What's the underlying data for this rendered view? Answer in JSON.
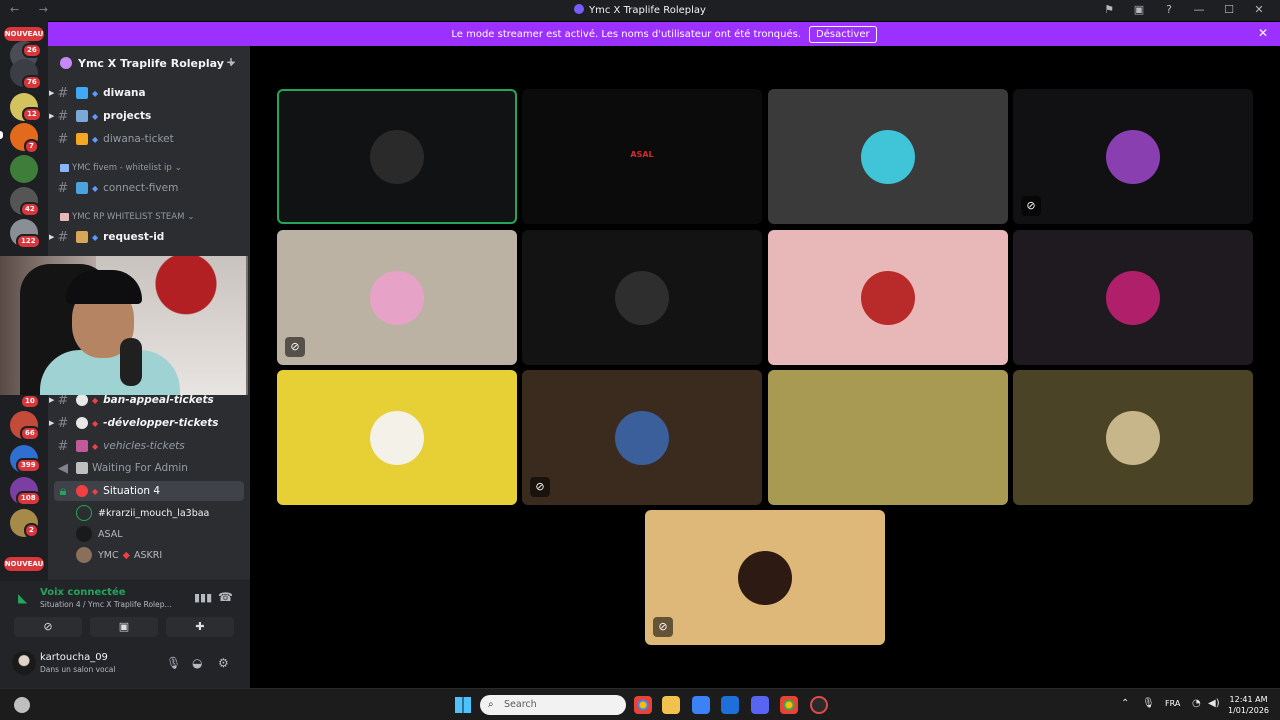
{
  "window": {
    "title": "Ymc X Traplife Roleplay",
    "nav_icons": "← →",
    "controls": [
      "⚑",
      "▣",
      "?",
      "—",
      "☐",
      "✕"
    ]
  },
  "banner": {
    "text": "Le mode streamer est activé. Les noms d'utilisateur ont été tronqués.",
    "button": "Désactiver",
    "close": "✕",
    "color": "#9b30ff"
  },
  "rail": {
    "new_label": "NOUVEAU",
    "badges": [
      "26",
      "76",
      "12",
      "7",
      "42",
      "122",
      "10",
      "66",
      "399",
      "108",
      "2"
    ]
  },
  "server": {
    "name": "Ymc X Traplife Roleplay",
    "chevron": "⌄",
    "invite_icon": "person-add"
  },
  "channels_top": [
    {
      "label": "diwana",
      "style": "bold",
      "emoji_color": "#3fa9f5"
    },
    {
      "label": "projects",
      "style": "bold",
      "emoji_color": "#7aa9d9"
    },
    {
      "label": "diwana-ticket",
      "style": "muted",
      "emoji_color": "#f5a623"
    }
  ],
  "categories": [
    {
      "label": "YMC fivem - whitelist ip"
    },
    {
      "label": "YMC RP WHITELIST STEAM"
    }
  ],
  "channels_mid": [
    {
      "label": "connect-fivem",
      "emoji_color": "#4aa3df"
    },
    {
      "label": "request-id",
      "emoji_color": "#d8a657"
    }
  ],
  "channels_bottom": [
    {
      "label": "ban-appeal-tickets"
    },
    {
      "label": "-développer-tickets"
    },
    {
      "label": "vehicles-tickets"
    },
    {
      "label": "Waiting For Admin"
    },
    {
      "label": "Situation 4"
    }
  ],
  "voice_users": [
    {
      "label": "#krarzii_mouch_la3baa"
    },
    {
      "label": "ASAL"
    },
    {
      "label": "YMC",
      "suffix": "ASKRI"
    }
  ],
  "voice_panel": {
    "status": "Voix connectée",
    "channel": "Situation 4 / Ymc X Traplife Rolep..."
  },
  "user": {
    "name": "kartoucha_09",
    "status": "Dans un salon vocal"
  },
  "tiles": [
    {
      "bg": "#111214",
      "avatar": "#2a2a2a",
      "speaking": true,
      "muted": false
    },
    {
      "bg": "#0b0b0c",
      "avatar": "transparent",
      "speaking": false,
      "muted": false,
      "text": "ASAL"
    },
    {
      "bg": "#3b3a3a",
      "avatar": "#3fc4d8",
      "speaking": false,
      "muted": false
    },
    {
      "bg": "#111113",
      "avatar": "#8a3fb0",
      "speaking": false,
      "muted": true
    },
    {
      "bg": "#bcb2a3",
      "avatar": "#e7a3c7",
      "speaking": false,
      "muted": true
    },
    {
      "bg": "#131313",
      "avatar": "#2e2e2e",
      "speaking": false,
      "muted": false
    },
    {
      "bg": "#e8b8b8",
      "avatar": "#b92a2a",
      "speaking": false,
      "muted": false
    },
    {
      "bg": "#1e1a20",
      "avatar": "#b0206a",
      "speaking": false,
      "muted": false
    },
    {
      "bg": "#e7d035",
      "avatar": "#f4f1e8",
      "speaking": false,
      "muted": false
    },
    {
      "bg": "#3a2b1e",
      "avatar": "#3a5f9a",
      "speaking": false,
      "muted": true
    },
    {
      "bg": "#a89a52",
      "avatar": "transparent",
      "speaking": false,
      "muted": false
    },
    {
      "bg": "#4a4326",
      "avatar": "#c7b68a",
      "speaking": false,
      "muted": false
    },
    {
      "bg": "#ddb878",
      "avatar": "#2d1a12",
      "speaking": false,
      "muted": true
    }
  ],
  "taskbar": {
    "search_placeholder": "Search",
    "language": "FRA",
    "time": "12:41 AM",
    "date": "1/01/2026"
  }
}
